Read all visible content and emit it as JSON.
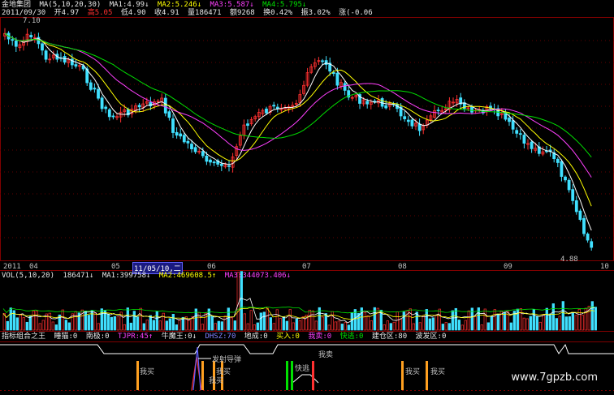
{
  "header": {
    "title": "金地集团",
    "ma_label": "MA(5,10,20,30)",
    "ma1": "MA1:4.99↓",
    "ma2": "MA2:5.246↓",
    "ma3": "MA3:5.587↓",
    "ma4": "MA4:5.795↓",
    "date": "2011/09/30",
    "open": "开4.97",
    "high": "高5.05",
    "low": "低4.90",
    "close": "收4.91",
    "volume": "量186471",
    "amount": "额9268",
    "turnover": "换0.42%",
    "amplitude": "振3.02%",
    "change": "涨(-0.06",
    "high_marker": "7.10",
    "low_marker": "4.88"
  },
  "time_axis": {
    "labels": [
      "2011",
      "04",
      "05",
      "06",
      "07",
      "08",
      "09",
      "10"
    ],
    "cursor_date": "11/05/10,二"
  },
  "volume_header": {
    "label": "VOL(5,10,20)",
    "value": "186471↓",
    "ma1": "MA1:399758↓",
    "ma2": "MA2:469608.5↑",
    "ma3": "MA3:344073.406↓"
  },
  "indicator_header": {
    "name": "指标组合之王",
    "items": [
      "睡猫:0",
      "南极:0",
      "TJPR:45↑",
      "牛魔王:0↓",
      "DHSZ:70",
      "地成:0",
      "买入:0",
      "我卖:0",
      "快逃:0",
      "建仓区:80",
      "波发区:0"
    ]
  },
  "signals": {
    "buy1": "我买",
    "missile": "发射导弹",
    "buy2": "我买",
    "buy3": "我买",
    "escape": "快逃",
    "sell": "我卖",
    "buy4": "我买",
    "buy5": "我买"
  },
  "watermark": "www.7gpzb.com",
  "colors": {
    "up": "#ff3030",
    "down": "#40e0ff",
    "ma5": "#ffffff",
    "ma10": "#ffff00",
    "ma20": "#ff40ff",
    "ma30": "#00e000"
  }
}
